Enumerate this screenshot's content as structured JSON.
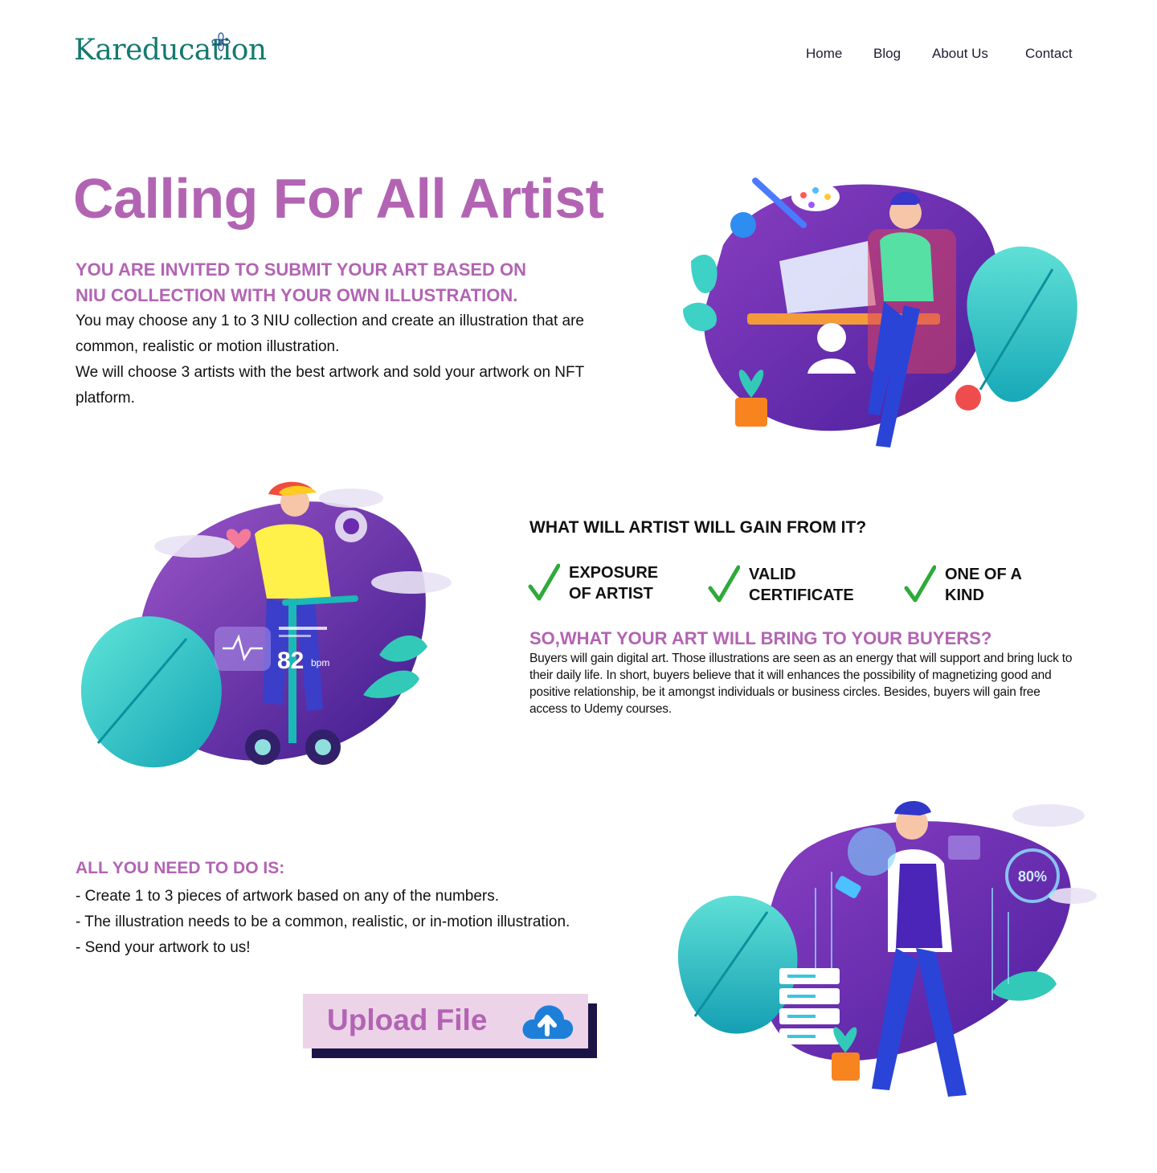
{
  "header": {
    "logo_text": "Kareducation",
    "nav": [
      {
        "label": "Home"
      },
      {
        "label": "Blog"
      },
      {
        "label": "About Us"
      },
      {
        "label": "Contact"
      }
    ]
  },
  "hero": {
    "title": "Calling For All Artist",
    "subtitle_line1": "YOU ARE INVITED TO SUBMIT YOUR ART BASED ON",
    "subtitle_line2": "NIU COLLECTION WITH YOUR OWN ILLUSTRATION.",
    "paragraph1": "You may choose any 1 to 3 NIU collection and create an illustration that are common, realistic or motion illustration.",
    "paragraph2": "We will choose 3 artists with the best artwork and sold your artwork on NFT platform."
  },
  "gain": {
    "title": "WHAT WILL ARTIST WILL GAIN FROM IT?",
    "items": [
      {
        "line1": "EXPOSURE",
        "line2": "OF ARTIST"
      },
      {
        "line1": "VALID",
        "line2": "CERTIFICATE"
      },
      {
        "line1": "ONE OF A",
        "line2": "KIND"
      }
    ]
  },
  "buyers": {
    "title": "SO,WHAT YOUR ART WILL BRING TO YOUR BUYERS?",
    "text": "Buyers will gain digital art. Those illustrations are seen as an energy that will support and bring luck to their daily life. In short, buyers believe that it will enhances the possibility of magnetizing good and positive relationship, be it amongst individuals or business circles. Besides, buyers will gain free access to Udemy courses."
  },
  "todo": {
    "title": "ALL YOU NEED TO DO IS:",
    "items": [
      "- Create 1 to 3 pieces of artwork based on any of the numbers.",
      "- The illustration needs to be a common, realistic, or in-motion illustration.",
      "- Send your artwork to us!"
    ]
  },
  "upload": {
    "label": "Upload File"
  },
  "illustrations": {
    "scooter_bpm_value": "82",
    "scooter_bpm_unit": "bpm",
    "dashboard_percent": "80%"
  },
  "colors": {
    "brand_teal": "#157a70",
    "accent_purple": "#b264b3",
    "upload_bg": "#ecd3e8",
    "upload_shadow": "#1b1447",
    "check_green": "#2eaa3a",
    "blob_purple": "#6a2bb0"
  }
}
